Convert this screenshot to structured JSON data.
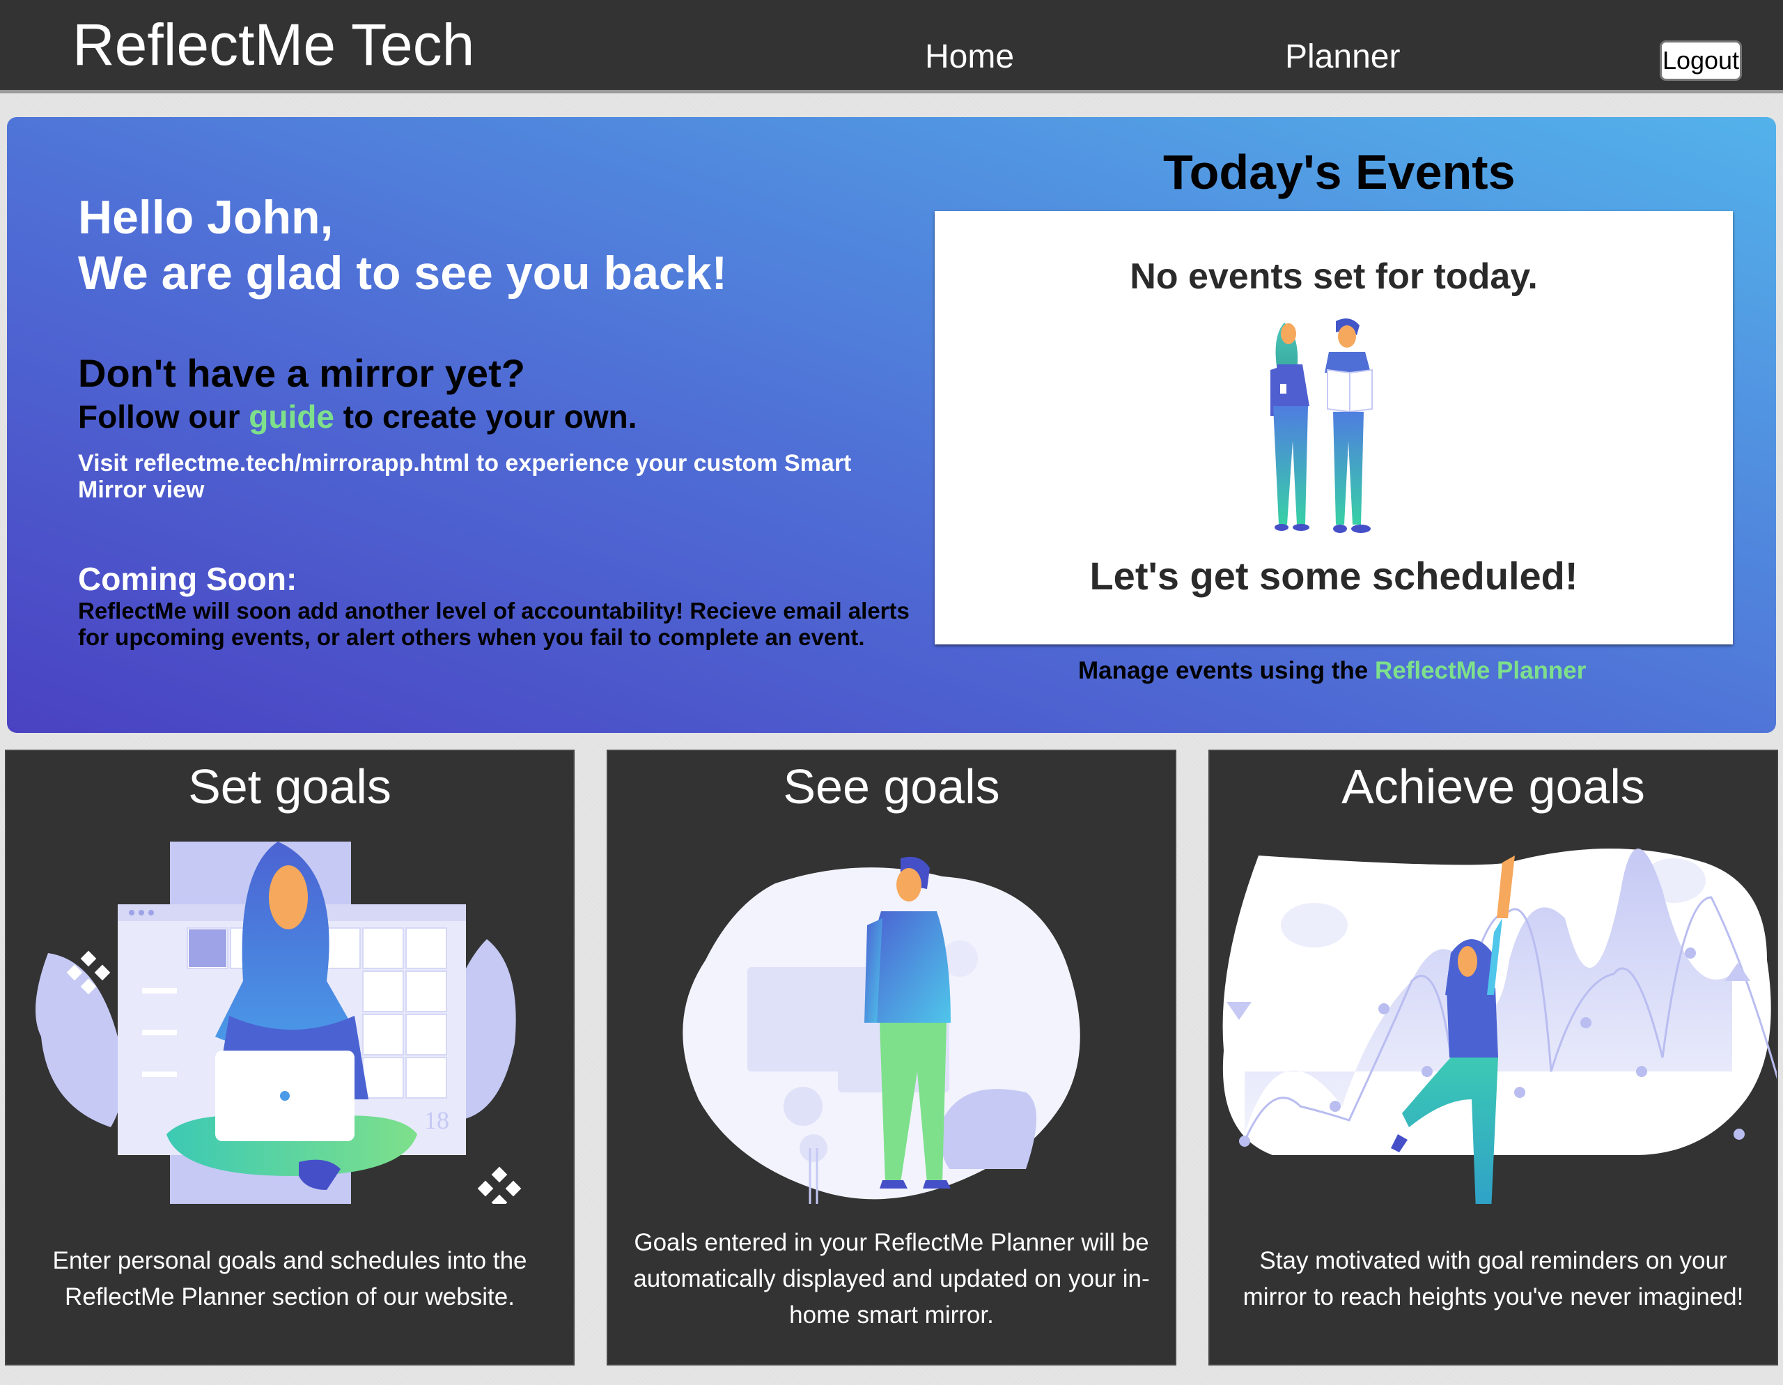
{
  "navbar": {
    "brand": "ReflectMe Tech",
    "links": [
      {
        "label": "Home"
      },
      {
        "label": "Planner"
      }
    ],
    "logout_label": "Logout"
  },
  "hero": {
    "greeting_line1": "Hello John,",
    "greeting_line2": "We are glad to see you back!",
    "mirror_title": "Don't have a mirror yet?",
    "guide_prefix": "Follow our",
    "guide_link": "guide",
    "guide_suffix": "to create your own.",
    "visit_text": "Visit reflectme.tech/mirrorapp.html to experience your custom Smart Mirror view",
    "coming_soon_title": "Coming Soon:",
    "coming_soon_text": "ReflectMe will soon add another level of accountability! Recieve email alerts for upcoming events, or alert others when you fail to complete an event."
  },
  "events": {
    "title": "Today's Events",
    "empty_message": "No events set for today.",
    "call_to_action": "Let's get some scheduled!",
    "manage_prefix": "Manage events using the",
    "manage_link": "ReflectMe Planner"
  },
  "cards": [
    {
      "title": "Set goals",
      "text": "Enter personal goals and schedules into the ReflectMe Planner section of our website."
    },
    {
      "title": "See goals",
      "text": "Goals entered in your ReflectMe Planner will be automatically displayed and updated on your in-home smart mirror."
    },
    {
      "title": "Achieve goals",
      "text": "Stay motivated with goal reminders on your mirror to reach heights you've never imagined!"
    }
  ],
  "illustration_labels": {
    "calendar_date": "18"
  },
  "colors": {
    "navbar_bg": "#333333",
    "hero_gradient_start": "#4a42c2",
    "hero_gradient_end": "#53b2ea",
    "link_green": "#7ee08b",
    "card_bg": "#333333",
    "illustration_lavender": "#c5c9f4"
  }
}
